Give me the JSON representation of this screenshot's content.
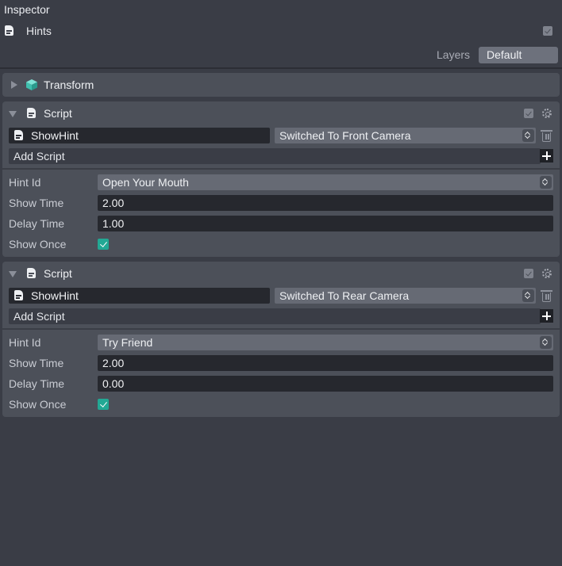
{
  "panel": {
    "title": "Inspector"
  },
  "object": {
    "name": "Hints",
    "icon": "document-icon"
  },
  "layers": {
    "label": "Layers",
    "value": "Default"
  },
  "transform": {
    "title": "Transform",
    "icon": "cube-icon"
  },
  "scripts": [
    {
      "title": "Script",
      "script_name": "ShowHint",
      "event": "Switched To Front Camera",
      "add_label": "Add Script",
      "properties": {
        "hint_id_label": "Hint Id",
        "hint_id_value": "Open Your Mouth",
        "show_time_label": "Show Time",
        "show_time_value": "2.00",
        "delay_time_label": "Delay Time",
        "delay_time_value": "1.00",
        "show_once_label": "Show Once",
        "show_once_checked": true
      }
    },
    {
      "title": "Script",
      "script_name": "ShowHint",
      "event": "Switched To Rear Camera",
      "add_label": "Add Script",
      "properties": {
        "hint_id_label": "Hint Id",
        "hint_id_value": "Try Friend",
        "show_time_label": "Show Time",
        "show_time_value": "2.00",
        "delay_time_label": "Delay Time",
        "delay_time_value": "0.00",
        "show_once_label": "Show Once",
        "show_once_checked": true
      }
    }
  ],
  "colors": {
    "background": "#3a3d46",
    "card": "#4c5059",
    "checkbox_accent": "#22a894",
    "transform_icon": "#4fd1c0"
  }
}
